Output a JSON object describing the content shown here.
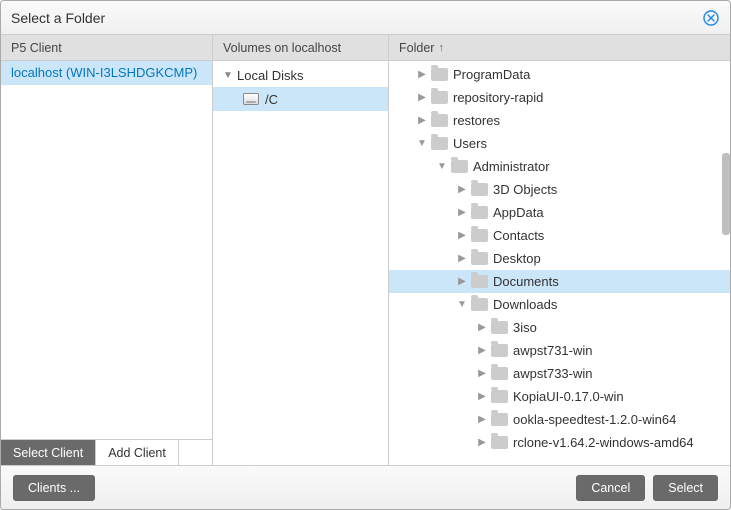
{
  "dialog": {
    "title": "Select a Folder"
  },
  "columns": {
    "client_header": "P5 Client",
    "volumes_header": "Volumes on localhost",
    "folder_header": "Folder",
    "sort_indicator": "↑"
  },
  "clients": [
    {
      "label": "localhost (WIN-I3LSHDGKCMP)",
      "selected": true
    }
  ],
  "client_tabs": {
    "select": "Select Client",
    "add": "Add Client"
  },
  "volumes": {
    "root": "Local Disks",
    "items": [
      {
        "label": "/C",
        "selected": true
      }
    ]
  },
  "folder_tree": [
    {
      "label": "ProgramData",
      "depth": 1,
      "expanded": false,
      "hasChildren": true
    },
    {
      "label": "repository-rapid",
      "depth": 1,
      "expanded": false,
      "hasChildren": true
    },
    {
      "label": "restores",
      "depth": 1,
      "expanded": false,
      "hasChildren": true
    },
    {
      "label": "Users",
      "depth": 1,
      "expanded": true,
      "hasChildren": true
    },
    {
      "label": "Administrator",
      "depth": 2,
      "expanded": true,
      "hasChildren": true
    },
    {
      "label": "3D Objects",
      "depth": 3,
      "expanded": false,
      "hasChildren": true
    },
    {
      "label": "AppData",
      "depth": 3,
      "expanded": false,
      "hasChildren": true
    },
    {
      "label": "Contacts",
      "depth": 3,
      "expanded": false,
      "hasChildren": true
    },
    {
      "label": "Desktop",
      "depth": 3,
      "expanded": false,
      "hasChildren": true
    },
    {
      "label": "Documents",
      "depth": 3,
      "expanded": false,
      "hasChildren": true,
      "selected": true
    },
    {
      "label": "Downloads",
      "depth": 3,
      "expanded": true,
      "hasChildren": true
    },
    {
      "label": "3iso",
      "depth": 4,
      "expanded": false,
      "hasChildren": true
    },
    {
      "label": "awpst731-win",
      "depth": 4,
      "expanded": false,
      "hasChildren": true
    },
    {
      "label": "awpst733-win",
      "depth": 4,
      "expanded": false,
      "hasChildren": true
    },
    {
      "label": "KopiaUI-0.17.0-win",
      "depth": 4,
      "expanded": false,
      "hasChildren": true
    },
    {
      "label": "ookla-speedtest-1.2.0-win64",
      "depth": 4,
      "expanded": false,
      "hasChildren": true
    },
    {
      "label": "rclone-v1.64.2-windows-amd64",
      "depth": 4,
      "expanded": false,
      "hasChildren": true
    }
  ],
  "footer": {
    "clients_button": "Clients ...",
    "cancel": "Cancel",
    "select": "Select"
  }
}
